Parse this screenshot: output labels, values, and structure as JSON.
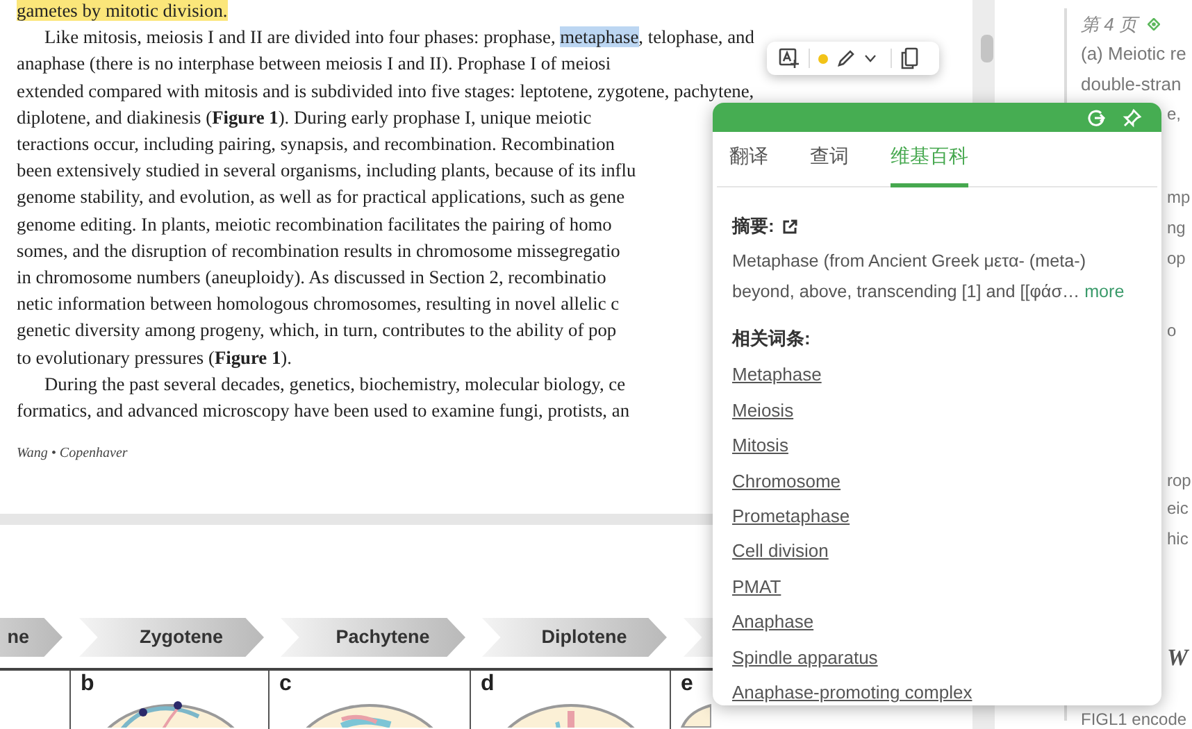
{
  "document": {
    "page_1": {
      "lines": [
        {
          "segments": [
            {
              "text": "gametes by mitotic division.",
              "color": "#fbe67a"
            }
          ]
        },
        {
          "indent": true,
          "segments": [
            {
              "text": "Like mitosis, meiosis I and II are divided into four phases: prophase, ",
              "selected": false
            },
            {
              "text": "metaphase",
              "selected": true
            },
            {
              "text": ", telophase, and",
              "selected": false
            }
          ]
        },
        {
          "segments": [
            {
              "text": "anaphase (there is no interphase between meiosis I and II). Prophase I of meiosi"
            }
          ]
        },
        {
          "segments": [
            {
              "text": "extended compared with mitosis and is subdivided into five stages: leptotene, zygotene, pachytene,"
            }
          ]
        },
        {
          "segments": [
            {
              "text": "diplotene, and diakinesis (**Figure 1**). During early prophase I, unique meiotic"
            }
          ]
        },
        {
          "segments": [
            {
              "text": "teractions occur, including pairing, synapsis, and recombination. Recombination"
            }
          ]
        },
        {
          "segments": [
            {
              "text": "been extensively studied in several organisms, including plants, because of its influ"
            }
          ]
        },
        {
          "segments": [
            {
              "text": "genome stability, and evolution, as well as for practical applications, such as gene"
            }
          ]
        },
        {
          "segments": [
            {
              "text": "genome editing. In plants, meiotic recombination facilitates the pairing of homo"
            }
          ]
        },
        {
          "segments": [
            {
              "text": "somes, and the disruption of recombination results in chromosome missegregatio"
            }
          ]
        },
        {
          "segments": [
            {
              "text": "in chromosome numbers (aneuploidy). As discussed in Section 2, recombinatio"
            }
          ]
        },
        {
          "segments": [
            {
              "text": "netic information between homologous chromosomes, resulting in novel allelic c"
            }
          ]
        },
        {
          "segments": [
            {
              "text": "genetic diversity among progeny, which, in turn, contributes to the ability of pop"
            }
          ]
        },
        {
          "segments": [
            {
              "text": "to evolutionary pressures (**Figure 1**)."
            }
          ]
        },
        {
          "indent": true,
          "segments": [
            {
              "text": "During the past several decades, genetics, biochemistry, molecular biology, ce"
            }
          ]
        },
        {
          "segments": [
            {
              "text": "formatics, and advanced microscopy have been used to examine fungi, protists, an"
            }
          ]
        }
      ],
      "footer": "Wang • Copenhaver"
    },
    "page_2": {
      "stages": [
        {
          "label": "ne"
        },
        {
          "label": "Zygotene"
        },
        {
          "label": "Pachytene"
        },
        {
          "label": "Diplotene"
        }
      ],
      "panels": [
        {
          "letter": "b"
        },
        {
          "letter": "c"
        },
        {
          "letter": "d"
        },
        {
          "letter": "e"
        }
      ]
    }
  },
  "notes_panel": {
    "page_label": "第 4 页",
    "lines": [
      "(a) Meiotic re",
      "double-stran"
    ],
    "fragments": [
      {
        "text": "e,",
        "kind": "body"
      },
      {
        "text": "mp",
        "kind": "body"
      },
      {
        "text": "ng",
        "kind": "body"
      },
      {
        "text": "op",
        "kind": "body"
      },
      {
        "text": "o",
        "kind": "body"
      },
      {
        "text": "rop",
        "kind": "body"
      },
      {
        "text": "eic",
        "kind": "body"
      },
      {
        "text": "hic",
        "kind": "body"
      },
      {
        "text": "W",
        "kind": "heading"
      }
    ],
    "bottom_line": "FIGL1 encode"
  },
  "popup": {
    "tabs": [
      {
        "label": "翻译",
        "selected": false
      },
      {
        "label": "查词",
        "selected": false
      },
      {
        "label": "维基百科",
        "selected": true
      }
    ],
    "summary": {
      "heading": "摘要:",
      "text": "Metaphase (from Ancient Greek μετα- (meta-) beyond, above, transcending [1] and [[φάσ…",
      "more": "more"
    },
    "related": {
      "heading": "相关词条:",
      "links": [
        "Metaphase",
        "Meiosis",
        "Mitosis",
        "Chromosome",
        "Prometaphase",
        "Cell division",
        "PMAT",
        "Anaphase",
        "Spindle apparatus",
        "Anaphase-promoting complex"
      ]
    }
  }
}
